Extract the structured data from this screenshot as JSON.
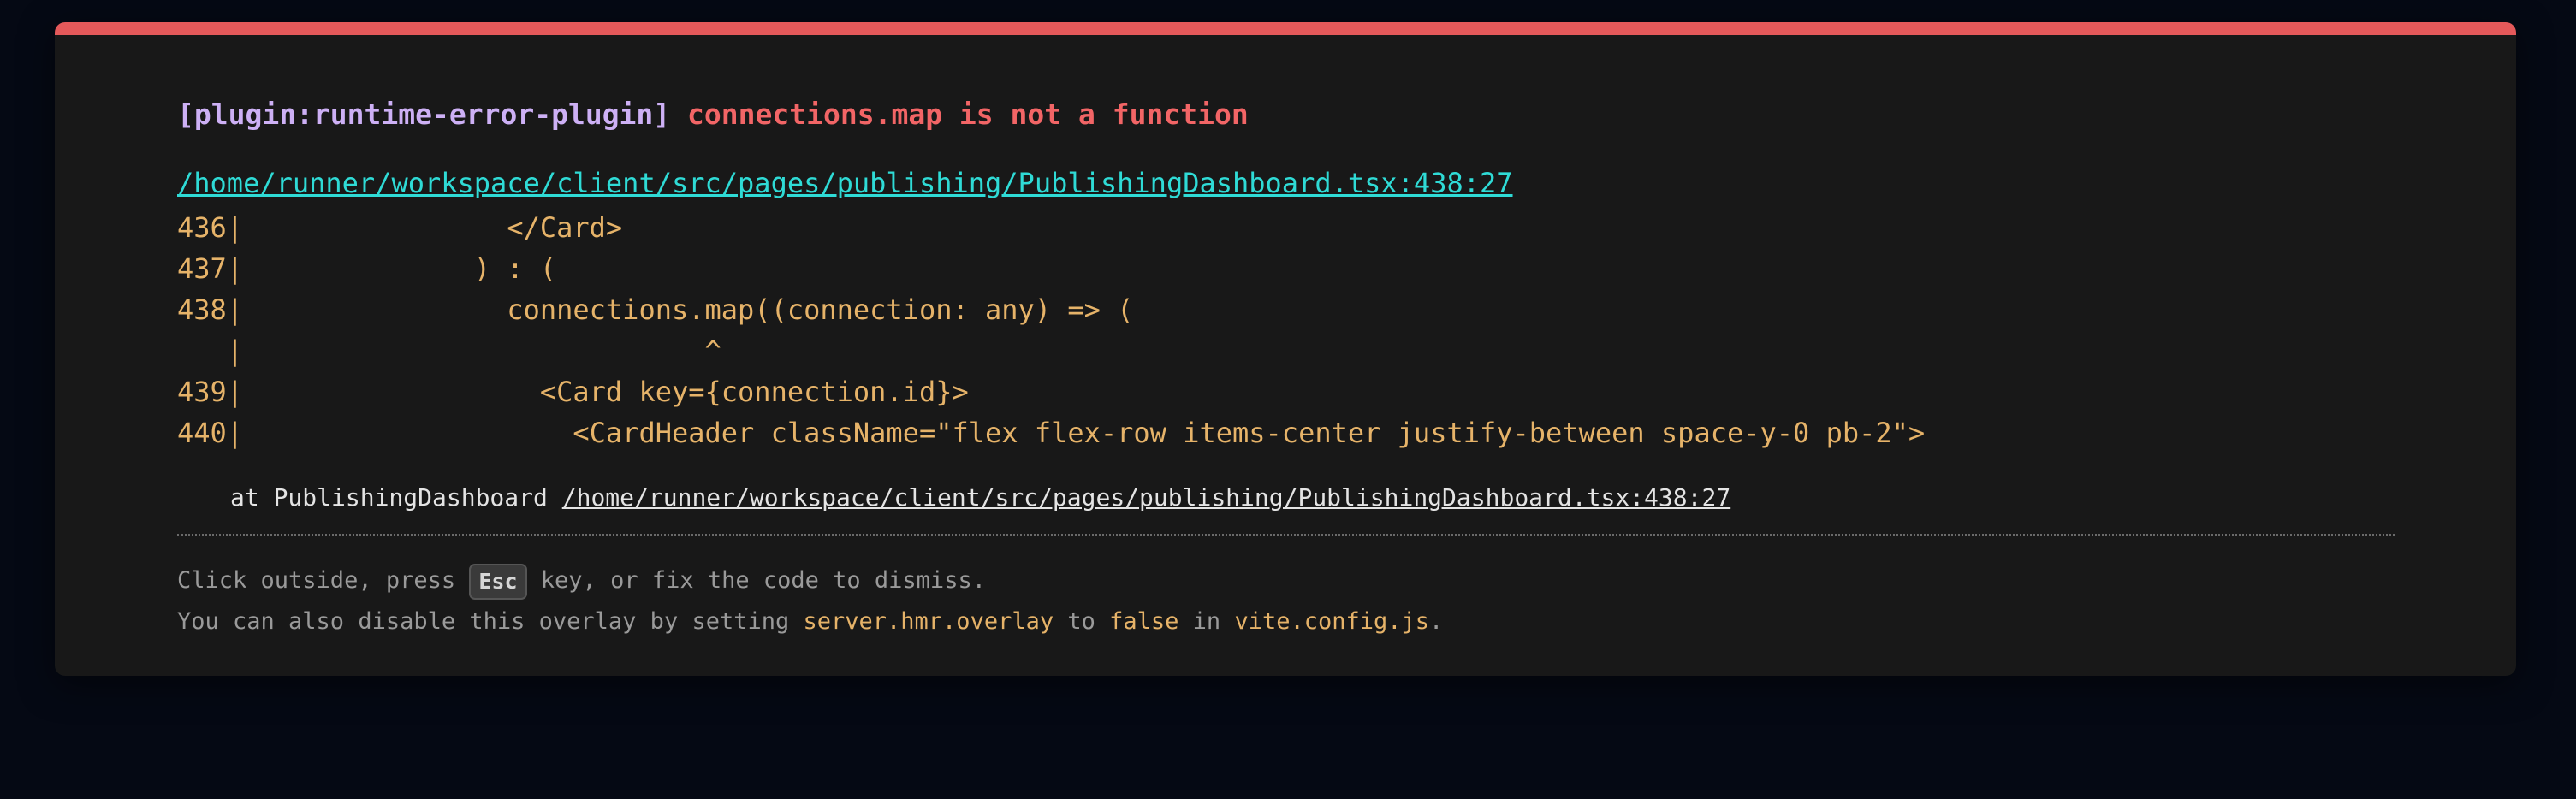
{
  "error": {
    "plugin": "[plugin:runtime-error-plugin]",
    "message": "connections.map is not a function",
    "file": "/home/runner/workspace/client/src/pages/publishing/PublishingDashboard.tsx:438:27"
  },
  "code_frame": [
    "436|                </Card>",
    "437|              ) : (",
    "438|                connections.map((connection: any) => (",
    "   |                            ^",
    "439|                  <Card key={connection.id}>",
    "440|                    <CardHeader className=\"flex flex-row items-center justify-between space-y-0 pb-2\">"
  ],
  "stack": {
    "prefix": "at PublishingDashboard ",
    "path": "/home/runner/workspace/client/src/pages/publishing/PublishingDashboard.tsx:438:27"
  },
  "tip": {
    "line1_before": "Click outside, press ",
    "key": "Esc",
    "line1_after": " key, or fix the code to dismiss.",
    "line2_a": "You can also disable this overlay by setting ",
    "line2_code1": "server.hmr.overlay",
    "line2_b": " to ",
    "line2_code2": "false",
    "line2_c": " in ",
    "line2_code3": "vite.config.js",
    "line2_d": "."
  },
  "colors": {
    "background": "#050914",
    "window": "#181818",
    "accent_bar": "#e4595a",
    "plugin_tag": "#cdb0f5",
    "error_message": "#f26566",
    "file_link": "#2fdbd6",
    "code": "#e6b369"
  }
}
